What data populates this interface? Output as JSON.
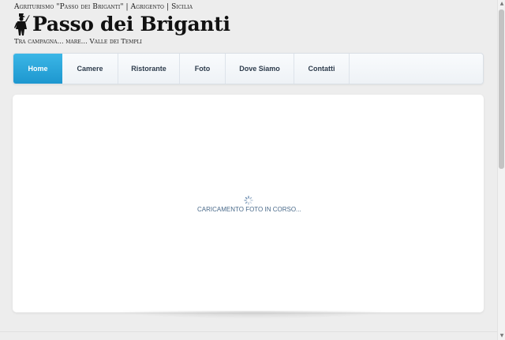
{
  "header": {
    "tagline": "Agriturismo \"Passo dei Briganti\" | Agrigento | Sicilia",
    "logo_text": "Passo dei Briganti",
    "subtitle": "Tra campagna... mare... Valle dei Templi"
  },
  "nav": {
    "items": [
      {
        "label": "Home",
        "active": true
      },
      {
        "label": "Camere",
        "active": false
      },
      {
        "label": "Ristorante",
        "active": false
      },
      {
        "label": "Foto",
        "active": false
      },
      {
        "label": "Dove Siamo",
        "active": false
      },
      {
        "label": "Contatti",
        "active": false
      }
    ]
  },
  "content": {
    "loading_text": "CARICAMENTO FOTO IN CORSO..."
  },
  "colors": {
    "accent": "#1d97cf",
    "loading_text": "#4a6a8a"
  },
  "icons": {
    "logo": "brigand-silhouette-icon",
    "loader": "spinner-icon"
  }
}
